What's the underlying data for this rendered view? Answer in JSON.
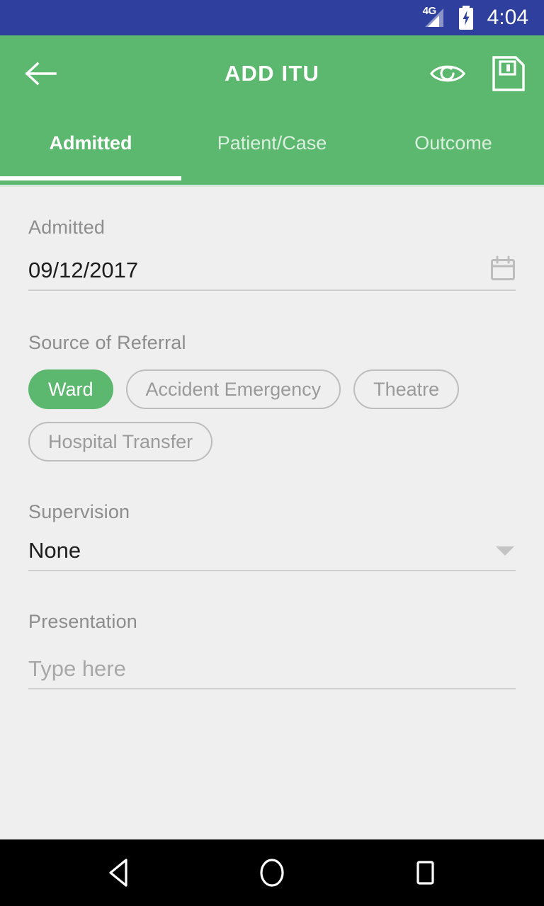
{
  "status_bar": {
    "network_label": "4G",
    "time": "4:04",
    "background_color": "#2e3f9e",
    "signal_icon": "signal-bars-icon",
    "battery_icon": "battery-charging-icon"
  },
  "app_bar": {
    "title": "ADD ITU",
    "background_color": "#5cb86f",
    "back_icon": "back-arrow-icon",
    "preview_icon": "eye-icon",
    "save_icon": "floppy-disk-save-icon"
  },
  "tabs": {
    "active_index": 0,
    "items": [
      {
        "label": "Admitted"
      },
      {
        "label": "Patient/Case"
      },
      {
        "label": "Outcome"
      }
    ]
  },
  "form": {
    "admitted": {
      "label": "Admitted",
      "value": "09/12/2017",
      "calendar_icon": "calendar-icon"
    },
    "source_of_referral": {
      "label": "Source of Referral",
      "selected": "Ward",
      "options": [
        {
          "label": "Ward",
          "selected": true
        },
        {
          "label": "Accident Emergency",
          "selected": false
        },
        {
          "label": "Theatre",
          "selected": false
        },
        {
          "label": "Hospital Transfer",
          "selected": false
        }
      ]
    },
    "supervision": {
      "label": "Supervision",
      "value": "None",
      "dropdown_icon": "chevron-down-icon"
    },
    "presentation": {
      "label": "Presentation",
      "value": "",
      "placeholder": "Type here"
    }
  },
  "nav_bar": {
    "background_color": "#000000",
    "items": [
      {
        "icon": "android-back-icon"
      },
      {
        "icon": "android-home-icon"
      },
      {
        "icon": "android-recents-icon"
      }
    ]
  }
}
